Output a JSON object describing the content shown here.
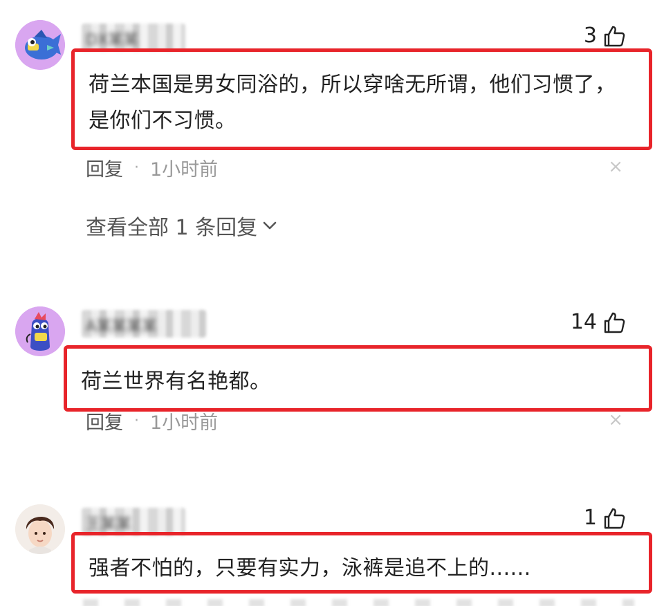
{
  "comments": [
    {
      "username": "DX某某",
      "likes": "3",
      "text": "荷兰本国是男女同浴的，所以穿啥无所谓，他们习惯了，是你们不习惯。",
      "reply_label": "回复",
      "separator": "·",
      "time": "1小时前",
      "close": "×",
      "view_replies": "查看全部 1 条回复"
    },
    {
      "username": "A某某某某",
      "likes": "14",
      "text": "荷兰世界有名艳都。",
      "reply_label": "回复",
      "separator": "·",
      "time": "1小时前",
      "close": "×"
    },
    {
      "username": "王某某",
      "likes": "1",
      "text": "强者不怕的，只要有实力，泳裤是追不上的......"
    }
  ],
  "icons": {
    "like": "thumbs-up-icon",
    "chevron": "chevron-down-icon"
  },
  "colors": {
    "highlight_border": "#e8242a",
    "avatar1_bg": "#d9a6f0",
    "avatar2_bg": "#d9a6f0"
  }
}
